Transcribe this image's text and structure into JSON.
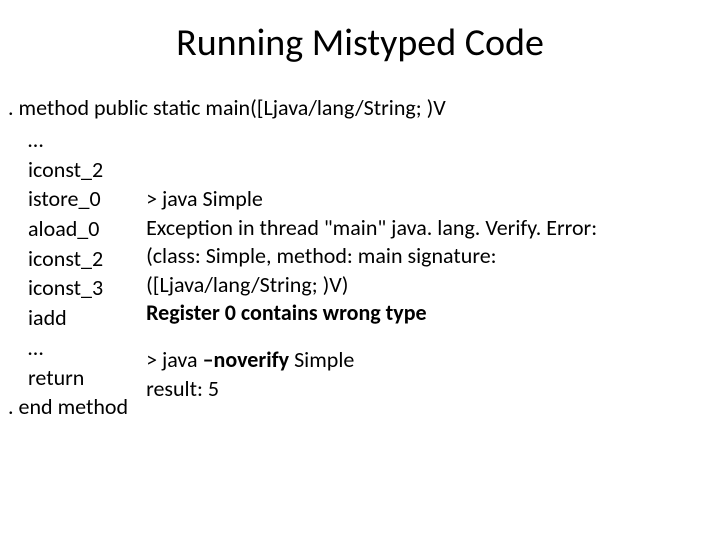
{
  "title": "Running Mistyped Code",
  "method_decl": ". method public static main([Ljava/lang/String; )V",
  "bytecode": {
    "l0": "…",
    "l1": "iconst_2",
    "l2": "istore_0",
    "l3": "aload_0",
    "l4": "iconst_2",
    "l5": "iconst_3",
    "l6": "iadd",
    "l7": "…",
    "l8": "return",
    "end": ". end method"
  },
  "output": {
    "cmd1": "> java Simple",
    "err1": "Exception in thread \"main\" java. lang. Verify. Error:",
    "err2": "(class: Simple, method: main signature:",
    "err3": "([Ljava/lang/String; )V)",
    "err4": "Register 0 contains wrong type",
    "cmd2_prefix": "> java ",
    "cmd2_flag": "–noverify",
    "cmd2_suffix": " Simple",
    "result": "result: 5"
  }
}
